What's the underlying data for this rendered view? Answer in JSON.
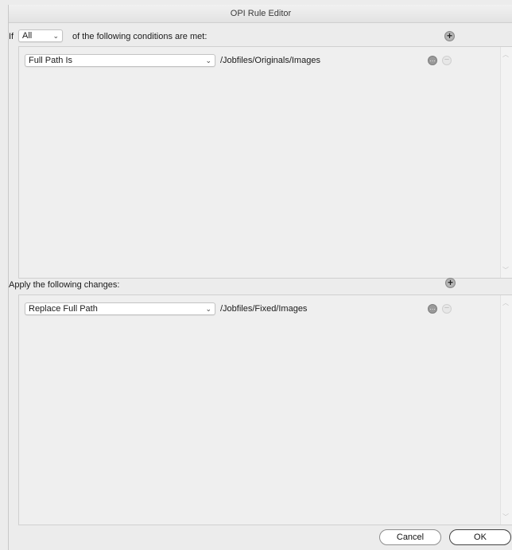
{
  "window": {
    "title": "OPI Rule Editor"
  },
  "conditions": {
    "if_label": "If",
    "match_mode": "All",
    "suffix_label": "of the following conditions are met:",
    "rows": [
      {
        "field": "Full Path Is",
        "value": "/Jobfiles/Originals/Images"
      }
    ]
  },
  "changes": {
    "header_label": "Apply the following changes:",
    "rows": [
      {
        "field": "Replace Full Path",
        "value": "/Jobfiles/Fixed/Images"
      }
    ]
  },
  "buttons": {
    "cancel": "Cancel",
    "ok": "OK"
  },
  "icons": {
    "add": "plus-circle-icon",
    "more": "ellipsis-circle-icon",
    "remove": "minus-circle-icon"
  }
}
